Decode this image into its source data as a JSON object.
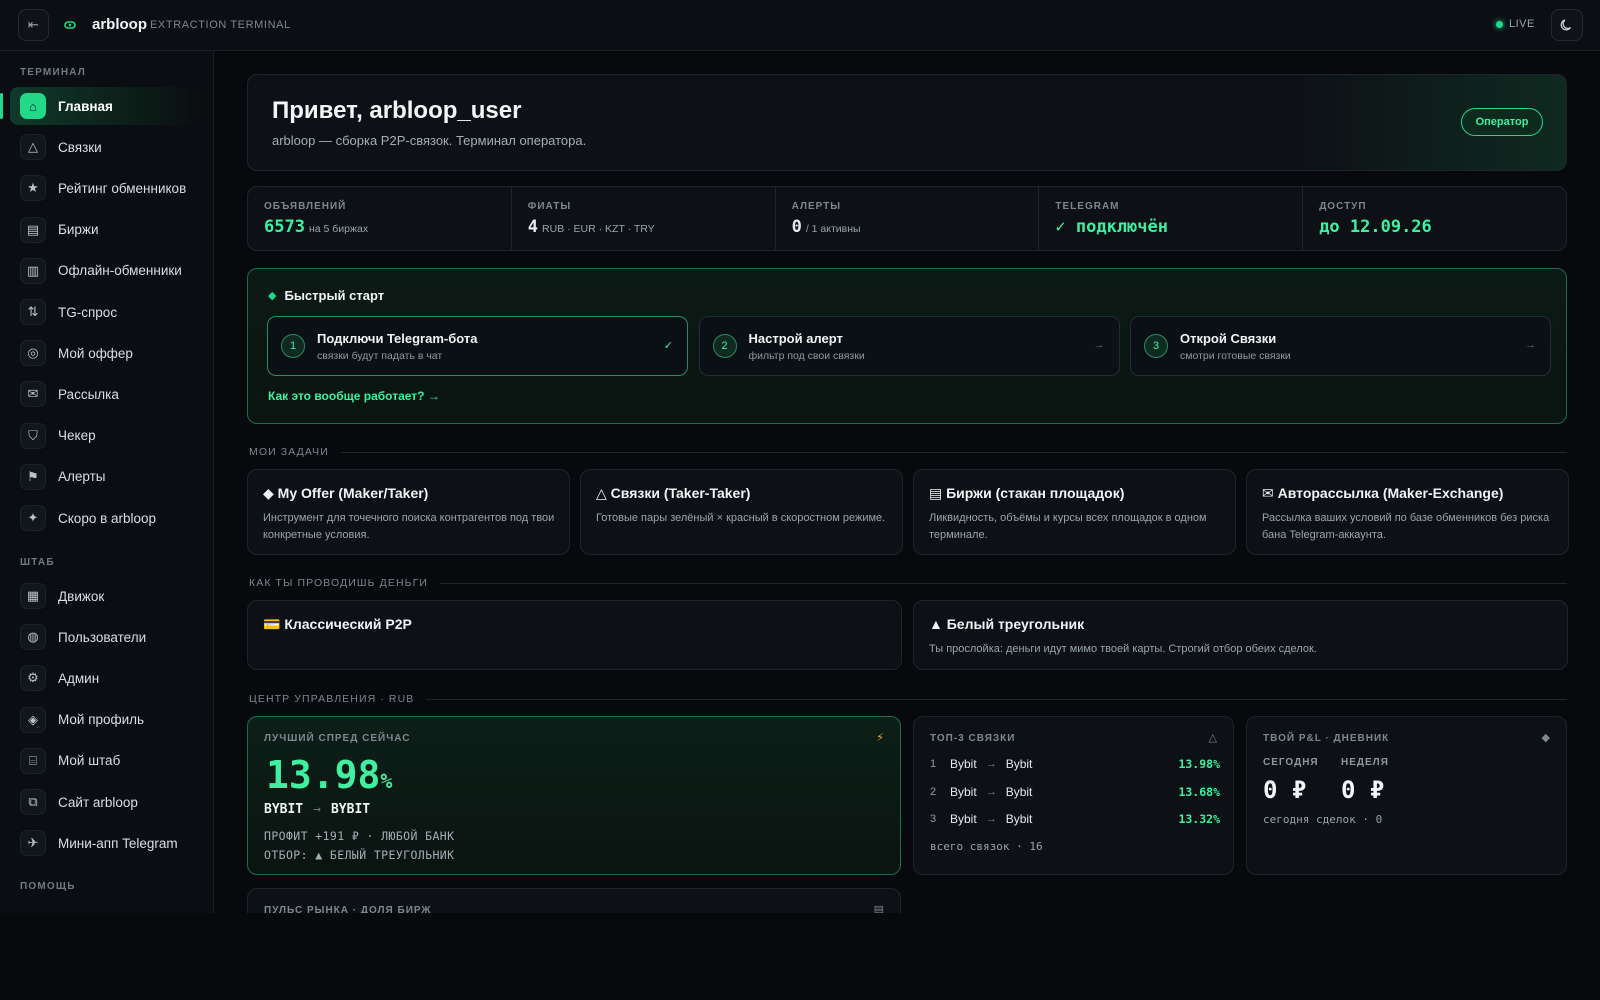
{
  "topbar": {
    "brand": "arbloop",
    "subtitle": "EXTRACTION TERMINAL",
    "live": "LIVE",
    "collapse_icon": "⇤"
  },
  "sidebar": {
    "section_terminal": "ТЕРМИНАЛ",
    "section_hq": "ШТАБ",
    "section_help": "ПОМОЩЬ",
    "items": [
      {
        "label": "Главная",
        "icon": "⌂",
        "name": "home"
      },
      {
        "label": "Связки",
        "icon": "△",
        "name": "links"
      },
      {
        "label": "Рейтинг обменников",
        "icon": "★",
        "name": "rating"
      },
      {
        "label": "Биржи",
        "icon": "▤",
        "name": "exchanges"
      },
      {
        "label": "Офлайн-обменники",
        "icon": "▥",
        "name": "offline"
      },
      {
        "label": "TG-спрос",
        "icon": "⇅",
        "name": "tg-demand"
      },
      {
        "label": "Мой оффер",
        "icon": "◎",
        "name": "my-offer"
      },
      {
        "label": "Рассылка",
        "icon": "✉",
        "name": "mailing"
      },
      {
        "label": "Чекер",
        "icon": "⛉",
        "name": "checker"
      },
      {
        "label": "Алерты",
        "icon": "⚑",
        "name": "alerts"
      },
      {
        "label": "Скоро в arbloop",
        "icon": "✦",
        "name": "soon"
      }
    ],
    "hq_items": [
      {
        "label": "Движок",
        "icon": "▦",
        "name": "engine"
      },
      {
        "label": "Пользователи",
        "icon": "◍",
        "name": "users"
      },
      {
        "label": "Админ",
        "icon": "⚙",
        "name": "admin"
      },
      {
        "label": "Мой профиль",
        "icon": "◈",
        "name": "profile"
      },
      {
        "label": "Мой штаб",
        "icon": "⌸",
        "name": "my-hq"
      },
      {
        "label": "Сайт arbloop",
        "icon": "⧉",
        "name": "site"
      },
      {
        "label": "Мини-апп Telegram",
        "icon": "✈",
        "name": "miniapp"
      }
    ]
  },
  "hero": {
    "title": "Привет, arbloop_user",
    "subtitle": "arbloop — сборка P2P-связок. Терминал оператора.",
    "role": "Оператор"
  },
  "stats": [
    {
      "label": "ОБЪЯВЛЕНИЙ",
      "value": "6573",
      "suffix": "на 5 биржах",
      "accent": true
    },
    {
      "label": "ФИАТЫ",
      "value": "4",
      "suffix": "RUB · EUR · KZT · TRY",
      "accent": false
    },
    {
      "label": "АЛЕРТЫ",
      "value": "0",
      "suffix": "/ 1 активны",
      "accent": false
    },
    {
      "label": "TELEGRAM",
      "value": "✓ подключён",
      "suffix": "",
      "accent": true
    },
    {
      "label": "ДОСТУП",
      "value": "до 12.09.26",
      "suffix": "",
      "accent": true
    }
  ],
  "quick_start": {
    "title": "Быстрый старт",
    "steps": [
      {
        "num": "1",
        "title": "Подключи Telegram-бота",
        "sub": "связки будут падать в чат",
        "mark": "✓"
      },
      {
        "num": "2",
        "title": "Настрой алерт",
        "sub": "фильтр под свои связки",
        "mark": "→"
      },
      {
        "num": "3",
        "title": "Открой Связки",
        "sub": "смотри готовые связки",
        "mark": "→"
      }
    ],
    "link": "Как это вообще работает? →"
  },
  "tasks": {
    "heading": "МОИ ЗАДАЧИ",
    "items": [
      {
        "title": "◆ My Offer (Maker/Taker)",
        "desc": "Инструмент для точечного поиска контрагентов под твои конкретные условия."
      },
      {
        "title": "△ Связки (Taker-Taker)",
        "desc": "Готовые пары зелёный × красный в скоростном режиме."
      },
      {
        "title": "▤ Биржи (стакан площадок)",
        "desc": "Ликвидность, объёмы и курсы всех площадок в одном терминале."
      },
      {
        "title": "✉ Авторассылка (Maker-Exchange)",
        "desc": "Рассылка ваших условий по базе обменников без риска бана Telegram-аккаунта."
      }
    ]
  },
  "money": {
    "heading": "КАК ТЫ ПРОВОДИШЬ ДЕНЬГИ",
    "items": [
      {
        "title": "💳 Классический P2P",
        "desc": ""
      },
      {
        "title": "▲ Белый треугольник",
        "desc": "Ты прослойка: деньги идут мимо твоей карты. Строгий отбор обеих сделок."
      }
    ]
  },
  "control": {
    "heading": "ЦЕНТР УПРАВЛЕНИЯ · RUB",
    "best": {
      "label": "ЛУЧШИЙ СПРЕД СЕЙЧАС",
      "icon": "⚡",
      "value": "13.98",
      "unit": "%",
      "from": "BYBIT",
      "arrow": "→",
      "to": "BYBIT",
      "profit": "ПРОФИТ +191 ₽ · ЛЮБОЙ БАНК",
      "filter": "ОТБОР: ▲ БЕЛЫЙ ТРЕУГОЛЬНИК"
    },
    "top3": {
      "label": "ТОП-3 СВЯЗКИ",
      "icon": "△",
      "rows": [
        {
          "rank": "1",
          "from": "Bybit",
          "to": "Bybit",
          "pct": "13.98%"
        },
        {
          "rank": "2",
          "from": "Bybit",
          "to": "Bybit",
          "pct": "13.68%"
        },
        {
          "rank": "3",
          "from": "Bybit",
          "to": "Bybit",
          "pct": "13.32%"
        }
      ],
      "total": "всего связок · 16"
    },
    "pnl": {
      "label": "ТВОЙ P&L · ДНЕВНИК",
      "icon": "◆",
      "today_label": "СЕГОДНЯ",
      "today_value": "0 ₽",
      "week_label": "НЕДЕЛЯ",
      "week_value": "0 ₽",
      "foot": "сегодня сделок · 0"
    },
    "pulse": {
      "label": "ПУЛЬС РЫНКА · ДОЛЯ БИРЖ",
      "icon": "▤"
    }
  },
  "colors": {
    "accent": "#22d98a",
    "accent_text": "#3ff0a0",
    "background": "#07090c",
    "card": "#0d1116"
  }
}
